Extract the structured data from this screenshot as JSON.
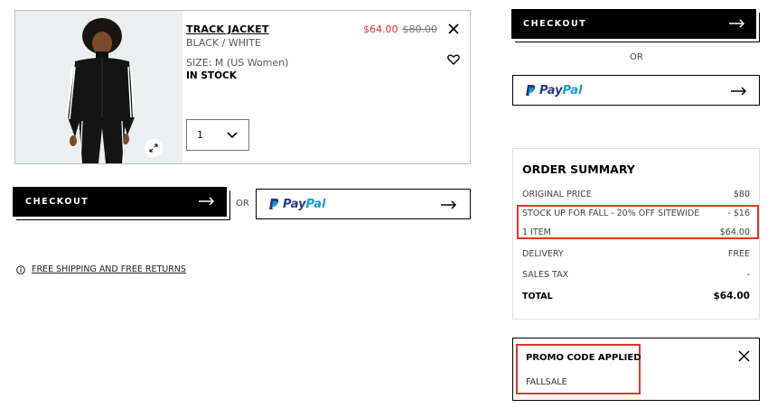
{
  "product": {
    "name": "TRACK JACKET",
    "color": "BLACK / WHITE",
    "size": "SIZE: M (US Women)",
    "stock": "IN STOCK",
    "sale_price": "$64.00",
    "original_price": "$80.00",
    "quantity": "1",
    "remove_icon": "close-icon",
    "wishlist_icon": "heart-icon",
    "expand_icon": "expand-icon"
  },
  "actions": {
    "checkout_label": "CHECKOUT",
    "or_label": "OR",
    "paypal_label_a": "Pay",
    "paypal_label_b": "Pal"
  },
  "shipping_note": "FREE SHIPPING AND FREE RETURNS",
  "summary": {
    "title": "ORDER SUMMARY",
    "rows": [
      {
        "label": "ORIGINAL PRICE",
        "value": "$80"
      },
      {
        "label": "STOCK UP FOR FALL - 20% OFF SITEWIDE",
        "value": "- $16"
      },
      {
        "label": "1 ITEM",
        "value": "$64.00"
      },
      {
        "label": "DELIVERY",
        "value": "FREE"
      },
      {
        "label": "SALES TAX",
        "value": "-"
      },
      {
        "label": "TOTAL",
        "value": "$64.00"
      }
    ]
  },
  "promo": {
    "title": "PROMO CODE APPLIED",
    "code": "FALLSALE"
  },
  "colors": {
    "sale_red": "#e32b2b",
    "highlight_red": "#e0362c",
    "paypal_dark": "#253b80",
    "paypal_light": "#179bd7"
  }
}
